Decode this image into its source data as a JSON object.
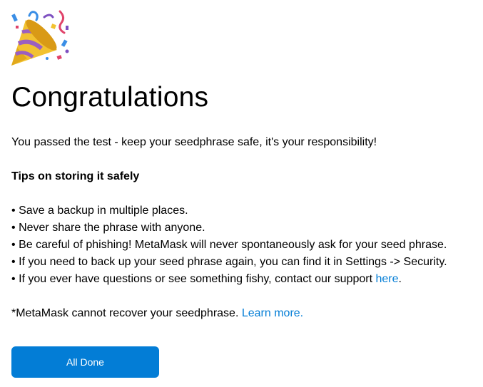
{
  "header": {
    "icon": "party-popper-icon",
    "title": "Congratulations"
  },
  "intro": {
    "passed_text": "You passed the test - keep your seedphrase safe, it's your responsibility!"
  },
  "tips": {
    "heading": "Tips on storing it safely",
    "bullet": "•",
    "items": [
      "Save a backup in multiple places.",
      "Never share the phrase with anyone.",
      "Be careful of phishing! MetaMask will never spontaneously ask for your seed phrase.",
      "If you need to back up your seed phrase again, you can find it in Settings -> Security.",
      "If you ever have questions or see something fishy, contact our support"
    ],
    "support_link": "here",
    "support_suffix": "."
  },
  "disclaimer": {
    "text": "*MetaMask cannot recover your seedphrase.",
    "link": "Learn more."
  },
  "actions": {
    "done_label": "All Done"
  },
  "colors": {
    "accent": "#037dd6",
    "text": "#000000",
    "background": "#ffffff"
  }
}
